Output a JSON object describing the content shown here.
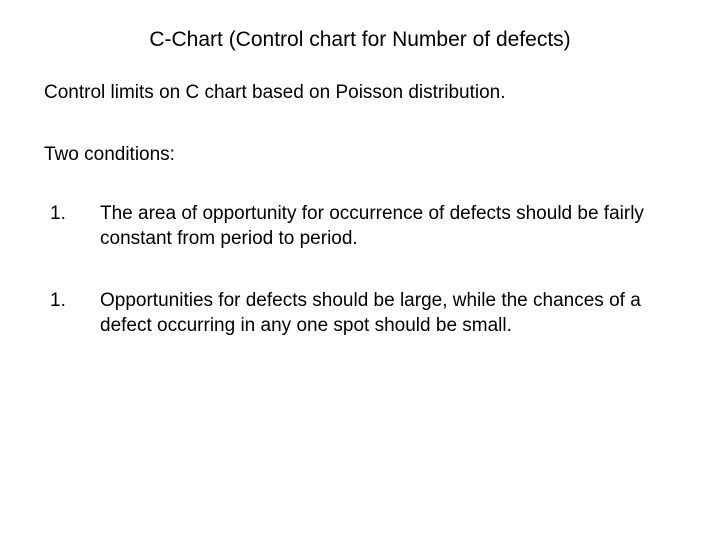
{
  "title": "C-Chart (Control chart for Number of defects)",
  "intro": "Control limits on C chart based on Poisson distribution.",
  "subhead": "Two conditions:",
  "items": [
    {
      "number": "1.",
      "text": "The area of opportunity for occurrence of defects should be fairly constant from period to period."
    },
    {
      "number": "1.",
      "text": "Opportunities for defects should be large, while the chances of a defect occurring in any one spot should be small."
    }
  ]
}
